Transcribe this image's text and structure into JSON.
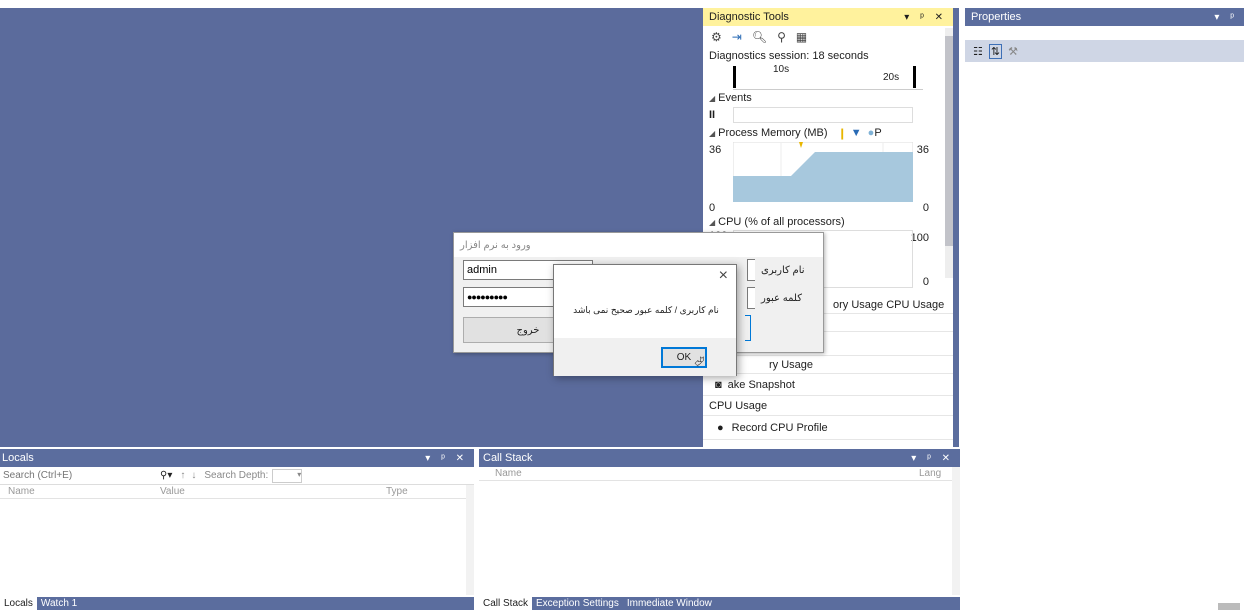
{
  "diagnostic_tools": {
    "title": "Diagnostic Tools",
    "session": "Diagnostics session: 18 seconds",
    "tick_10s": "10s",
    "tick_20s": "20s",
    "events_label": "Events",
    "pause_glyph": "II",
    "process_memory_label": "Process Memory (MB)",
    "memory_legend_p": "P",
    "mem_max_left": "36",
    "mem_max_right": "36",
    "mem_min_left": "0",
    "mem_min_right": "0",
    "cpu_label": "CPU (% of all processors)",
    "cpu_max_left": "100",
    "cpu_max_right": "100",
    "cpu_min_right": "0",
    "tabs_text": "ory Usage  CPU Usage",
    "memory_usage_partial": "ry Usage",
    "take_snapshot": "ake Snapshot",
    "cpu_usage_header": "CPU Usage",
    "record_cpu_profile": "Record CPU Profile"
  },
  "properties": {
    "title": "Properties"
  },
  "locals": {
    "title": "Locals",
    "search_placeholder": "Search (Ctrl+E)",
    "search_depth_label": "Search Depth:",
    "col_name": "Name",
    "col_value": "Value",
    "col_type": "Type",
    "tabs": [
      "Locals",
      "Watch 1"
    ]
  },
  "callstack": {
    "title": "Call Stack",
    "col_name": "Name",
    "col_lang": "Lang",
    "tabs": [
      "Call Stack",
      "Exception Settings",
      "Immediate Window"
    ]
  },
  "login_form": {
    "title": "ورود به نرم افزار",
    "username_value": "admin",
    "password_value": "●●●●●●●●●",
    "username_label": "نام کاربری",
    "password_label": "کلمه عبور",
    "exit_button": "خروج"
  },
  "message_box": {
    "message": "نام کاربری / کلمه عبور صحیح نمی باشد",
    "ok_button": "OK",
    "close_glyph": "×"
  },
  "colors": {
    "editor_bg": "#5b6b9c",
    "active_title": "#fff29d",
    "panel_title": "#5b6d9e",
    "memory_fill": "#a7c8dd"
  }
}
